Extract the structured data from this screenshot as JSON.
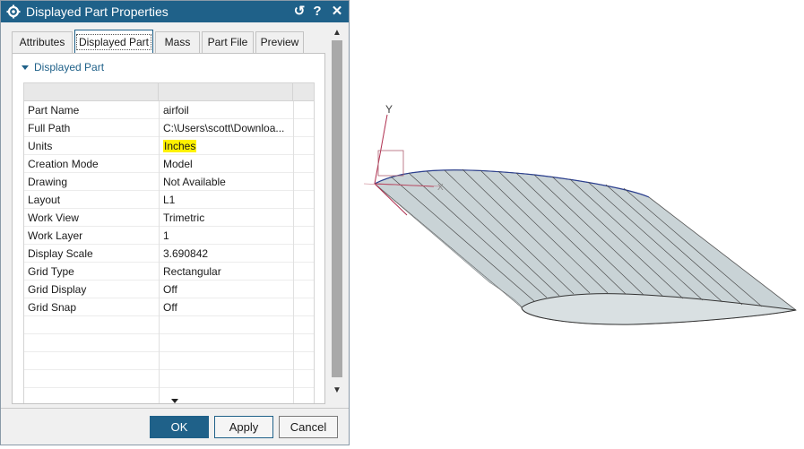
{
  "dialog": {
    "title": "Displayed Part Properties",
    "controls": {
      "reset": "↺",
      "help": "?",
      "close": "✕"
    }
  },
  "tabs": [
    {
      "label": "Attributes",
      "active": false
    },
    {
      "label": "Displayed Part",
      "active": true
    },
    {
      "label": "Mass",
      "active": false
    },
    {
      "label": "Part File",
      "active": false
    },
    {
      "label": "Preview",
      "active": false
    }
  ],
  "group": {
    "title": "Displayed Part"
  },
  "properties": [
    {
      "key": "Part Name",
      "value": "airfoil"
    },
    {
      "key": "Full Path",
      "value": "C:\\Users\\scott\\Downloa..."
    },
    {
      "key": "Units",
      "value": "Inches",
      "highlight": true
    },
    {
      "key": "Creation Mode",
      "value": "Model"
    },
    {
      "key": "Drawing",
      "value": "Not Available"
    },
    {
      "key": "Layout",
      "value": "L1"
    },
    {
      "key": "Work View",
      "value": "Trimetric"
    },
    {
      "key": "Work Layer",
      "value": "1"
    },
    {
      "key": "Display Scale",
      "value": "3.690842"
    },
    {
      "key": "Grid Type",
      "value": "Rectangular"
    },
    {
      "key": "Grid Display",
      "value": "Off"
    },
    {
      "key": "Grid Snap",
      "value": "Off"
    }
  ],
  "buttons": {
    "ok": "OK",
    "apply": "Apply",
    "cancel": "Cancel"
  },
  "viewport": {
    "axes": {
      "y": "Y",
      "x": "X"
    }
  },
  "colors": {
    "titlebar": "#1f6189",
    "highlight": "#fff200",
    "model_fill": "#c9d3d6",
    "model_edge": "#2b3f8f"
  },
  "icons": [
    "gear-icon",
    "reset-icon",
    "help-icon",
    "close-icon",
    "chevron-up-icon",
    "chevron-down-icon",
    "expand-more-icon",
    "collapse-triangle-icon"
  ]
}
